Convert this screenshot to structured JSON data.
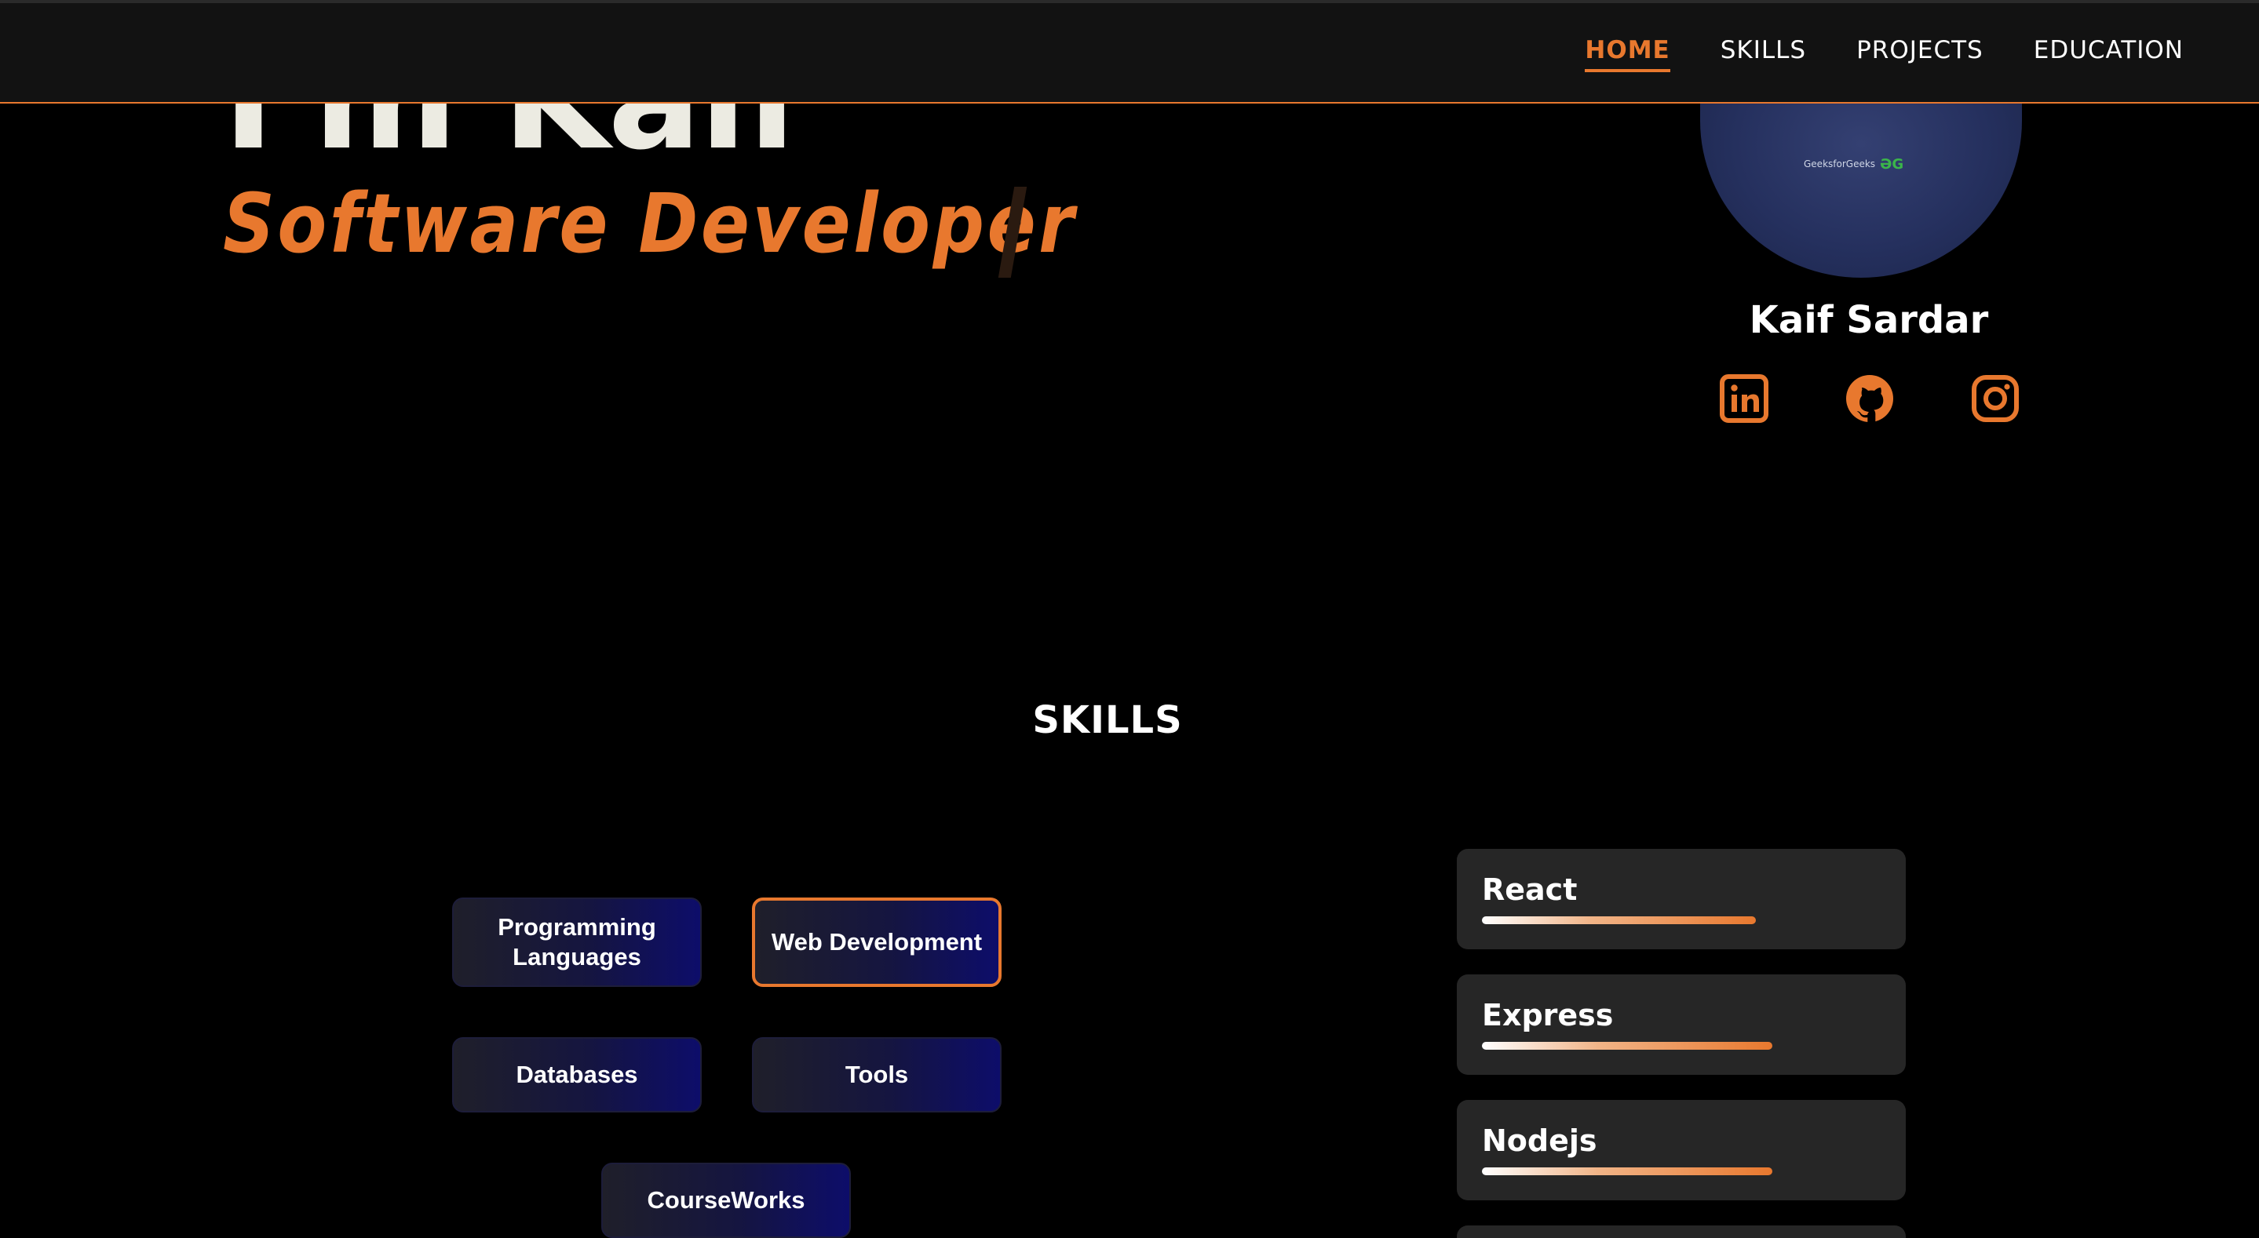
{
  "nav": {
    "items": [
      {
        "label": "HOME",
        "active": true
      },
      {
        "label": "SKILLS",
        "active": false
      },
      {
        "label": "PROJECTS",
        "active": false
      },
      {
        "label": "EDUCATION",
        "active": false
      }
    ]
  },
  "hero": {
    "greeting": "I'm Kaif",
    "role": "Software Developer"
  },
  "profile": {
    "name": "Kaif Sardar",
    "shirt_text": "GeeksforGeeks",
    "socials": [
      {
        "icon": "linkedin-icon"
      },
      {
        "icon": "github-icon"
      },
      {
        "icon": "instagram-icon"
      }
    ]
  },
  "skills": {
    "title": "SKILLS",
    "categories": [
      {
        "label": "Programming Languages",
        "active": false
      },
      {
        "label": "Web Development",
        "active": true
      },
      {
        "label": "Databases",
        "active": false
      },
      {
        "label": "Tools",
        "active": false
      },
      {
        "label": "CourseWorks",
        "active": false
      }
    ],
    "items": [
      {
        "name": "React",
        "level": 0.83
      },
      {
        "name": "Express",
        "level": 0.88
      },
      {
        "name": "Nodejs",
        "level": 0.88
      }
    ]
  },
  "colors": {
    "accent": "#e8782e",
    "background": "#000000",
    "navbar": "#121212",
    "card": "#262626"
  }
}
